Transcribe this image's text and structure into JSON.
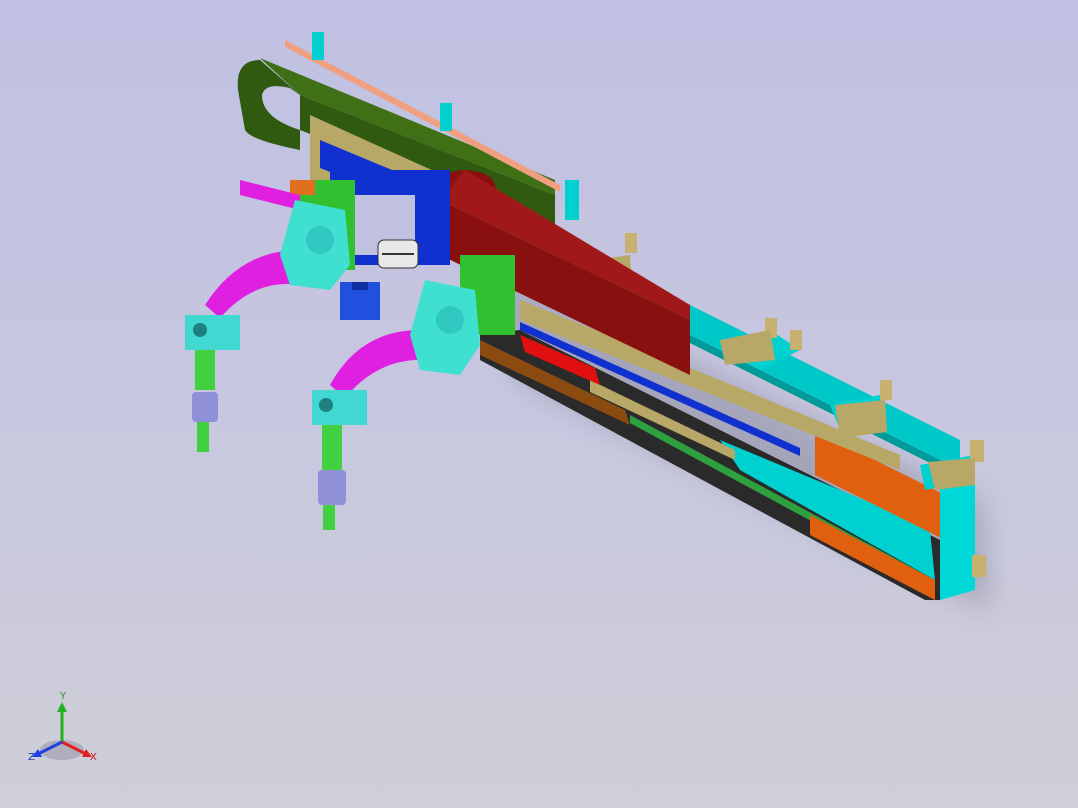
{
  "viewport": {
    "background_top": "#c0c0e2",
    "background_bottom": "#cfcfd8"
  },
  "triad": {
    "x_label": "X",
    "y_label": "Y",
    "z_label": "Z",
    "x_color": "#e02020",
    "y_color": "#20b020",
    "z_color": "#2040e0"
  },
  "model": {
    "icon": "gantry-manipulator-assembly",
    "colors": {
      "cable_chain": "#2f5a0f",
      "cable_chain_2": "#8a1010",
      "beam": "#00d0d0",
      "tan_plate": "#b8a868",
      "orange_rail": "#e06010",
      "dark_rail": "#2a2a2a",
      "blue_rail": "#1030d0",
      "red_strip": "#e01010",
      "gripper": "#40e0d0",
      "magenta_arm": "#e020e0",
      "green_joint": "#30d040",
      "salmon_strip": "#f0a080"
    }
  }
}
